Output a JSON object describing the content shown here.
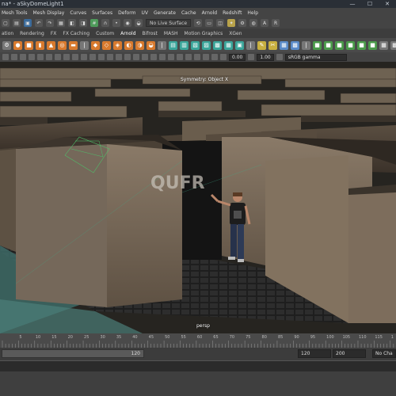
{
  "window": {
    "title": "na* - aSkyDomeLight1",
    "min": "—",
    "max": "☐",
    "close": "✕"
  },
  "menu": [
    "Mesh Tools",
    "Mesh Display",
    "Curves",
    "Surfaces",
    "Deform",
    "UV",
    "Generate",
    "Cache",
    "Arnold",
    "Redshift",
    "Help"
  ],
  "status": {
    "live_surface": "No Live Surface"
  },
  "shelf_tabs": [
    "ation",
    "Rendering",
    "FX",
    "FX Caching",
    "Custom",
    "Arnold",
    "Bifrost",
    "MASH",
    "Motion Graphics",
    "XGen"
  ],
  "panel": {
    "field_a": "0.00",
    "field_b": "1.00",
    "colorspace": "sRGB gamma"
  },
  "viewport": {
    "hud_top": "Symmetry: Object X",
    "hud_bottom": "persp",
    "graffiti": "QUFR"
  },
  "timeline": {
    "ticks": [
      "5",
      "10",
      "15",
      "20",
      "25",
      "30",
      "35",
      "40",
      "45",
      "50",
      "55",
      "60",
      "65",
      "70",
      "75",
      "80",
      "85",
      "90",
      "95",
      "100",
      "105",
      "110",
      "115",
      "1"
    ],
    "range_end": "120",
    "end_a": "120",
    "end_b": "200",
    "no_char": "No Cha"
  }
}
